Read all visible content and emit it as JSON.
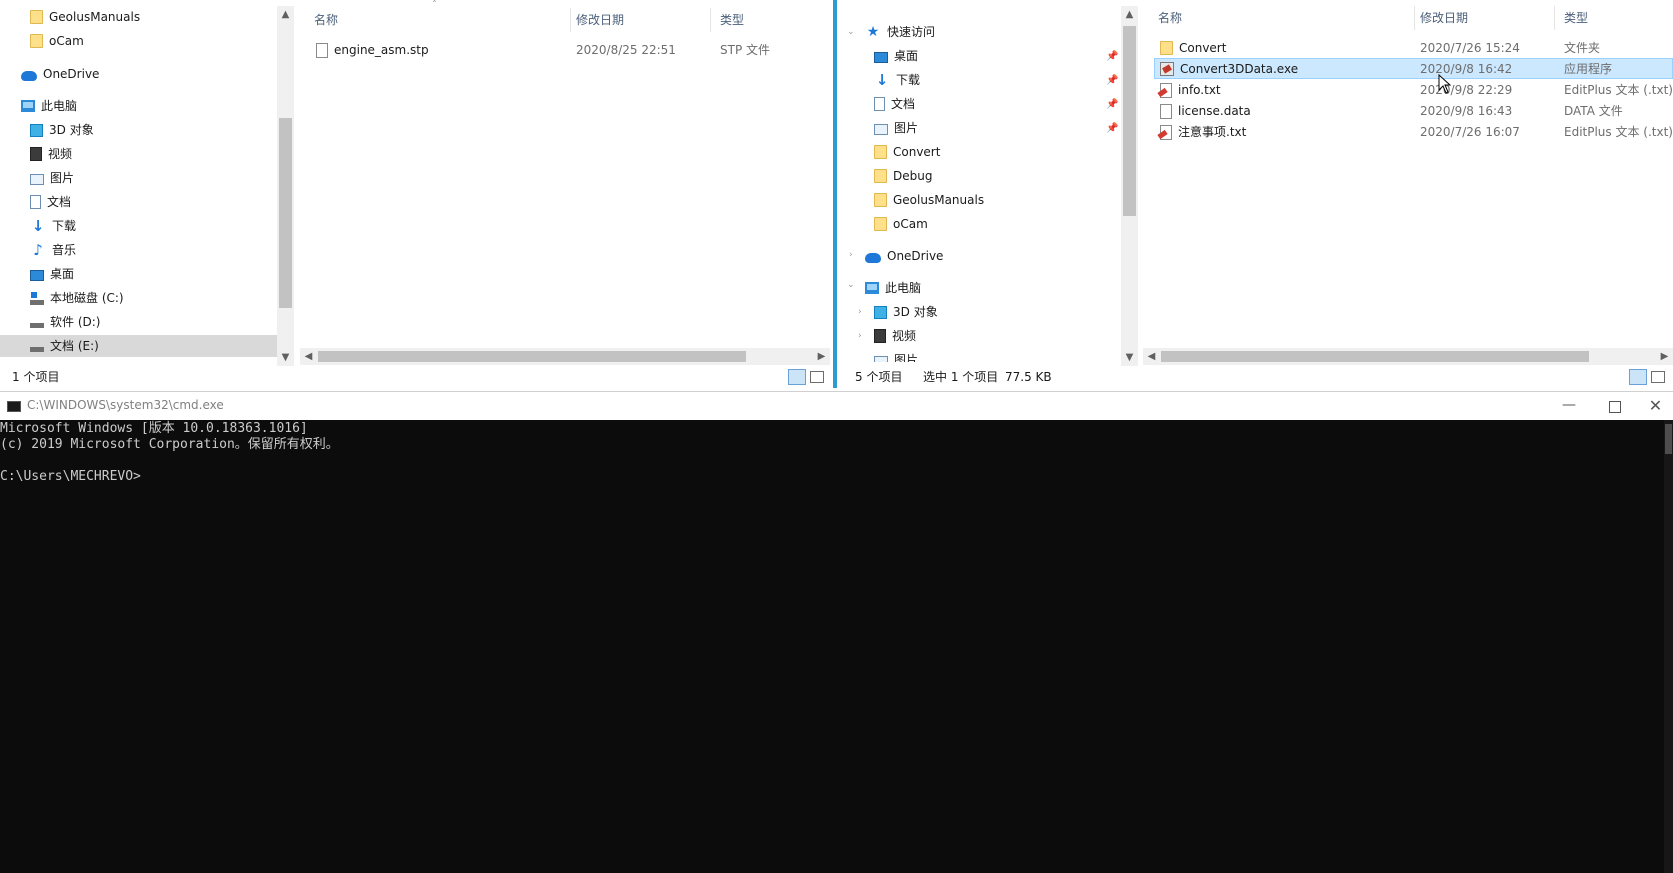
{
  "left_explorer": {
    "nav_items": [
      {
        "label": "GeolusManuals",
        "icon": "folder-icon"
      },
      {
        "label": "oCam",
        "icon": "folder-icon"
      },
      {
        "label": "OneDrive",
        "icon": "onedrive-icon"
      },
      {
        "label": "此电脑",
        "icon": "this-pc-icon"
      },
      {
        "label": "3D 对象",
        "icon": "3d-objects-icon"
      },
      {
        "label": "视频",
        "icon": "video-icon"
      },
      {
        "label": "图片",
        "icon": "pictures-icon"
      },
      {
        "label": "文档",
        "icon": "documents-icon"
      },
      {
        "label": "下载",
        "icon": "download-icon"
      },
      {
        "label": "音乐",
        "icon": "music-icon"
      },
      {
        "label": "桌面",
        "icon": "desktop-icon"
      },
      {
        "label": "本地磁盘 (C:)",
        "icon": "drive-c-icon"
      },
      {
        "label": "软件 (D:)",
        "icon": "drive-icon"
      },
      {
        "label": "文档 (E:)",
        "icon": "drive-icon"
      }
    ],
    "columns": {
      "name": "名称",
      "date": "修改日期",
      "type": "类型"
    },
    "files": [
      {
        "name": "engine_asm.stp",
        "date": "2020/8/25 22:51",
        "type": "STP 文件",
        "icon": "file-icon"
      }
    ],
    "status": "1 个项目"
  },
  "right_explorer": {
    "nav_items": [
      {
        "label": "快速访问",
        "icon": "quick-access-icon"
      },
      {
        "label": "桌面",
        "icon": "desktop-icon",
        "pinned": true
      },
      {
        "label": "下载",
        "icon": "download-icon",
        "pinned": true
      },
      {
        "label": "文档",
        "icon": "documents-icon",
        "pinned": true
      },
      {
        "label": "图片",
        "icon": "pictures-icon",
        "pinned": true
      },
      {
        "label": "Convert",
        "icon": "folder-icon"
      },
      {
        "label": "Debug",
        "icon": "folder-icon"
      },
      {
        "label": "GeolusManuals",
        "icon": "folder-icon"
      },
      {
        "label": "oCam",
        "icon": "folder-icon"
      },
      {
        "label": "OneDrive",
        "icon": "onedrive-icon"
      },
      {
        "label": "此电脑",
        "icon": "this-pc-icon"
      },
      {
        "label": "3D 对象",
        "icon": "3d-objects-icon"
      },
      {
        "label": "视频",
        "icon": "video-icon"
      },
      {
        "label": "图片",
        "icon": "pictures-icon"
      }
    ],
    "columns": {
      "name": "名称",
      "date": "修改日期",
      "type": "类型"
    },
    "files": [
      {
        "name": "Convert",
        "date": "2020/7/26 15:24",
        "type": "文件夹",
        "icon": "folder-icon"
      },
      {
        "name": "Convert3DData.exe",
        "date": "2020/9/8 16:42",
        "type": "应用程序",
        "icon": "exe-icon",
        "selected": true
      },
      {
        "name": "info.txt",
        "date": "2020/9/8 22:29",
        "type": "EditPlus 文本 (.txt)",
        "icon": "text-file-icon"
      },
      {
        "name": "license.data",
        "date": "2020/9/8 16:43",
        "type": "DATA 文件",
        "icon": "file-icon"
      },
      {
        "name": "注意事项.txt",
        "date": "2020/7/26 16:07",
        "type": "EditPlus 文本 (.txt)",
        "icon": "text-file-icon"
      }
    ],
    "status_count": "5 个项目",
    "status_selection": "选中 1 个项目",
    "status_size": "77.5 KB"
  },
  "cmd": {
    "title": "C:\\WINDOWS\\system32\\cmd.exe",
    "lines": [
      "Microsoft Windows [版本 10.0.18363.1016]",
      "(c) 2019 Microsoft Corporation。保留所有权利。",
      "",
      "C:\\Users\\MECHREVO>"
    ]
  }
}
